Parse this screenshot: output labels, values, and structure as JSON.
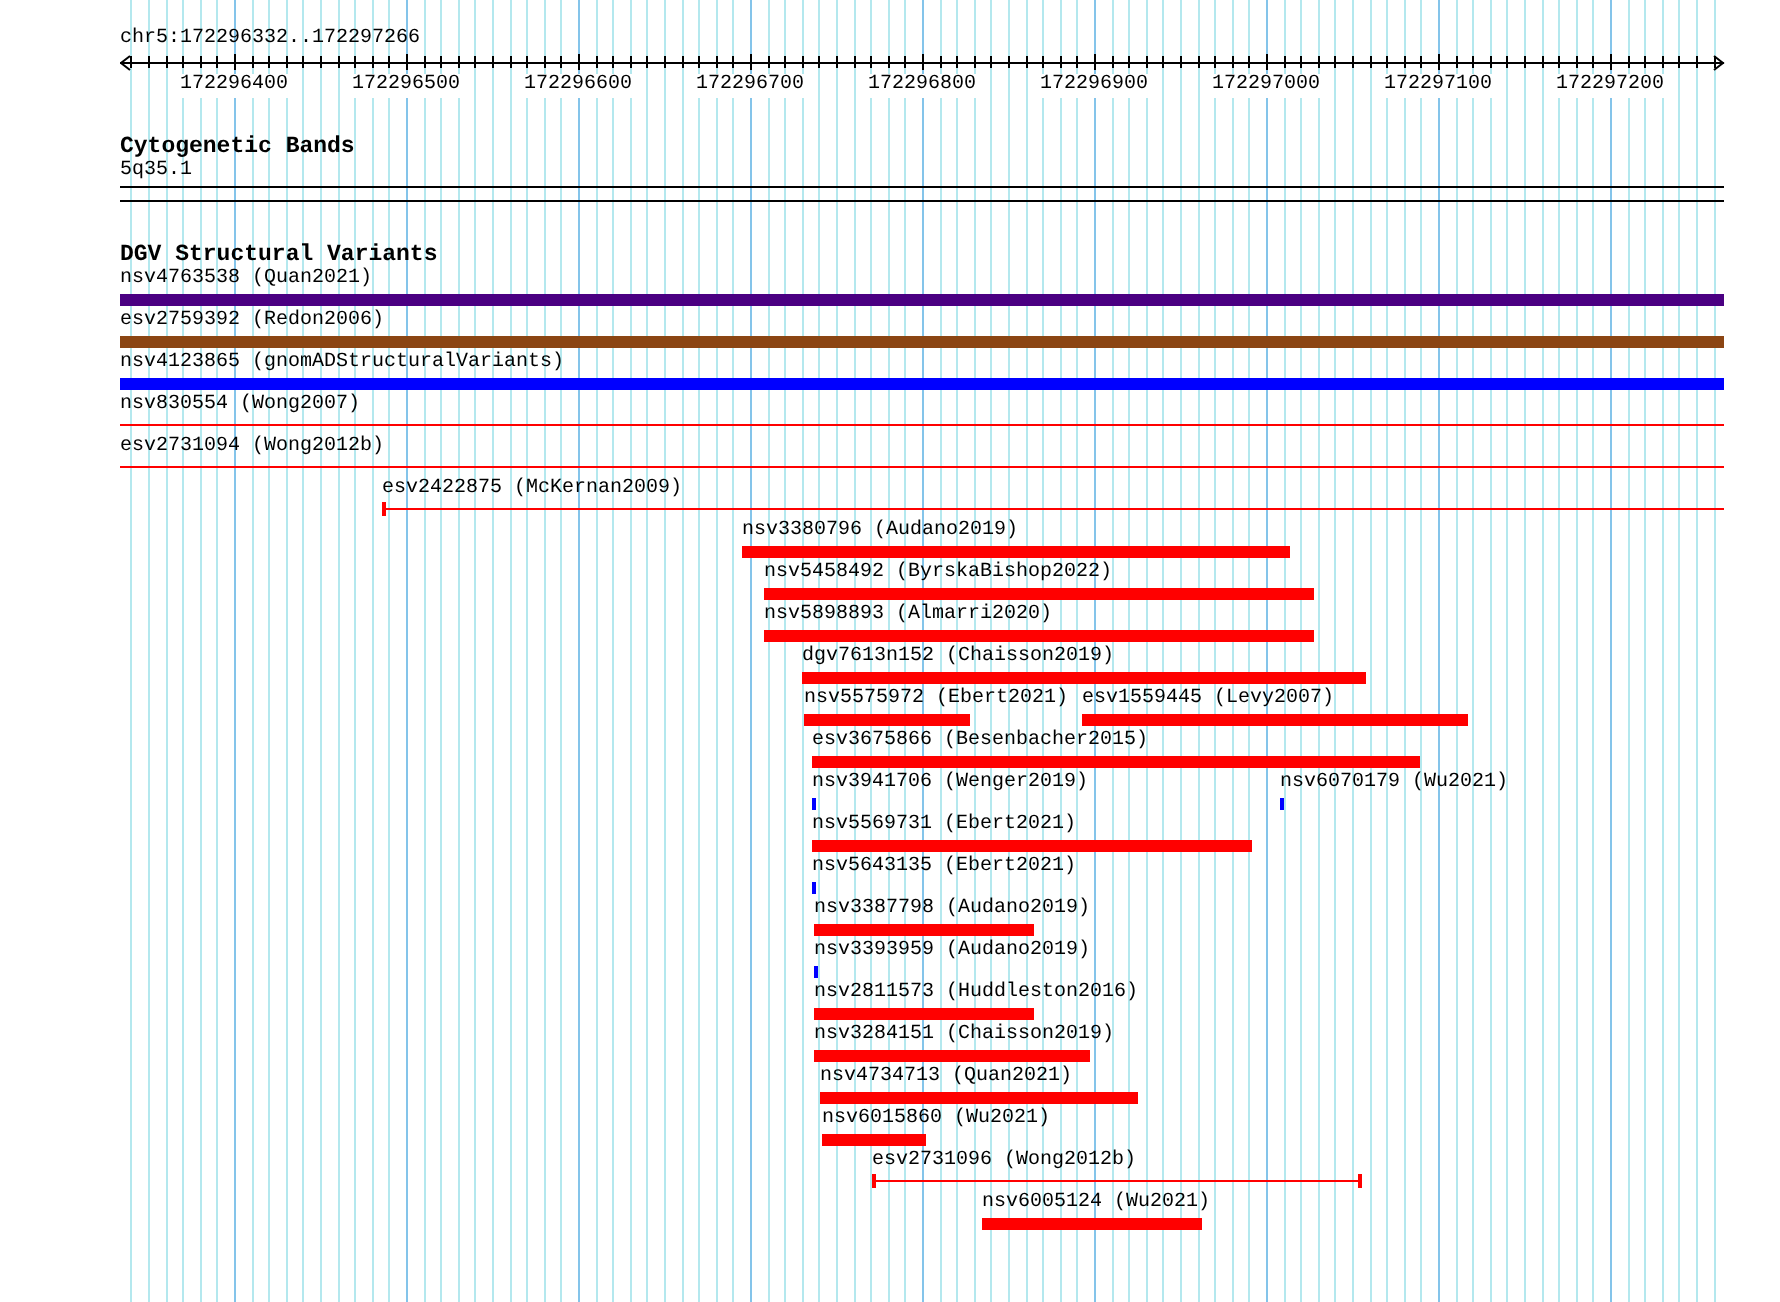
{
  "ruler": {
    "location": "chr5:172296332..172297266",
    "ticks": [
      "172296400",
      "172296500",
      "172296600",
      "172296700",
      "172296800",
      "172296900",
      "172297000",
      "172297100",
      "172297200"
    ]
  },
  "tracks": [
    {
      "title": "Cytogenetic Bands",
      "kind": "bands",
      "features": [
        {
          "label": "5q35.1"
        }
      ]
    },
    {
      "title": "DGV Structural Variants",
      "kind": "variants",
      "features": [
        {
          "label": "nsv4763538 (Quan2021)",
          "kind": "bar",
          "color": "#4b0082"
        },
        {
          "label": "esv2759392 (Redon2006)",
          "kind": "bar",
          "color": "#8b4513"
        },
        {
          "label": "nsv4123865 (gnomADStructuralVariants)",
          "kind": "bar",
          "color": "#0000ff"
        },
        {
          "label": "nsv830554 (Wong2007)",
          "kind": "line",
          "color": "#ff0000"
        },
        {
          "label": "esv2731094 (Wong2012b)",
          "kind": "line",
          "color": "#ff0000"
        },
        {
          "label": "esv2422875 (McKernan2009)",
          "kind": "whisker",
          "color": "#ff0000"
        },
        {
          "label": "nsv3380796 (Audano2019)",
          "kind": "bar",
          "color": "#ff0000"
        },
        {
          "label": "nsv5458492 (ByrskaBishop2022)",
          "kind": "bar",
          "color": "#ff0000"
        },
        {
          "label": "nsv5898893 (Almarri2020)",
          "kind": "bar",
          "color": "#ff0000"
        },
        {
          "label": "dgv7613n152 (Chaisson2019)",
          "kind": "bar",
          "color": "#ff0000"
        },
        {
          "label": "nsv5575972 (Ebert2021)",
          "kind": "bar",
          "color": "#ff0000"
        },
        {
          "label": "esv1559445 (Levy2007)",
          "kind": "bar",
          "color": "#ff0000"
        },
        {
          "label": "esv3675866 (Besenbacher2015)",
          "kind": "bar",
          "color": "#ff0000"
        },
        {
          "label": "nsv3941706 (Wenger2019)",
          "kind": "point",
          "color": "#0000ff"
        },
        {
          "label": "nsv6070179 (Wu2021)",
          "kind": "point",
          "color": "#0000ff"
        },
        {
          "label": "nsv5569731 (Ebert2021)",
          "kind": "bar",
          "color": "#ff0000"
        },
        {
          "label": "nsv5643135 (Ebert2021)",
          "kind": "point",
          "color": "#0000ff"
        },
        {
          "label": "nsv3387798 (Audano2019)",
          "kind": "bar",
          "color": "#ff0000"
        },
        {
          "label": "nsv3393959 (Audano2019)",
          "kind": "point",
          "color": "#0000ff"
        },
        {
          "label": "nsv2811573 (Huddleston2016)",
          "kind": "bar",
          "color": "#ff0000"
        },
        {
          "label": "nsv3284151 (Chaisson2019)",
          "kind": "bar",
          "color": "#ff0000"
        },
        {
          "label": "nsv4734713 (Quan2021)",
          "kind": "bar",
          "color": "#ff0000"
        },
        {
          "label": "nsv6015860 (Wu2021)",
          "kind": "bar",
          "color": "#ff0000"
        },
        {
          "label": "esv2731096 (Wong2012b)",
          "kind": "whisker",
          "color": "#ff0000"
        },
        {
          "label": "nsv6005124 (Wu2021)",
          "kind": "bar",
          "color": "#ff0000"
        }
      ]
    }
  ]
}
